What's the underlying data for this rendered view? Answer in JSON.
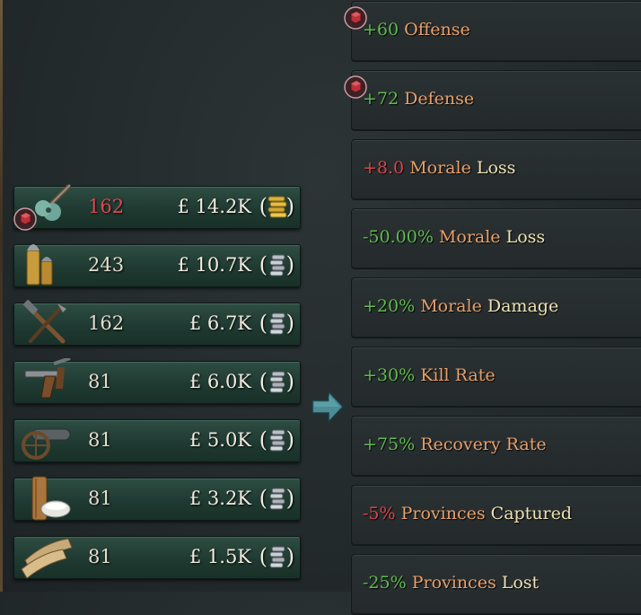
{
  "goods": [
    {
      "amount": "162",
      "shortage": true,
      "price": "£ 14.2K",
      "icon": "small-arms-icon",
      "coin": "gold-coin-stack-icon",
      "has_flag": true
    },
    {
      "amount": "243",
      "shortage": false,
      "price": "£ 10.7K",
      "icon": "ammunition-icon",
      "coin": "silver-coin-stack-icon",
      "has_flag": false
    },
    {
      "amount": "162",
      "shortage": false,
      "price": "£ 6.7K",
      "icon": "tools-icon",
      "coin": "silver-coin-stack-icon",
      "has_flag": false
    },
    {
      "amount": "81",
      "shortage": false,
      "price": "£ 6.0K",
      "icon": "pistol-icon",
      "coin": "silver-coin-stack-icon",
      "has_flag": false
    },
    {
      "amount": "81",
      "shortage": false,
      "price": "£ 5.0K",
      "icon": "artillery-icon",
      "coin": "silver-coin-stack-icon",
      "has_flag": false
    },
    {
      "amount": "81",
      "shortage": false,
      "price": "£ 3.2K",
      "icon": "rubber-icon",
      "coin": "silver-coin-stack-icon",
      "has_flag": false
    },
    {
      "amount": "81",
      "shortage": false,
      "price": "£ 1.5K",
      "icon": "fabric-icon",
      "coin": "silver-coin-stack-icon",
      "has_flag": false
    }
  ],
  "modifiers": [
    {
      "value": "+60",
      "sign": "pos",
      "word1": "Offense",
      "word2": "",
      "has_flag": true
    },
    {
      "value": "+72",
      "sign": "pos",
      "word1": "Defense",
      "word2": "",
      "has_flag": true
    },
    {
      "value": "+8.0",
      "sign": "neg",
      "word1": "Morale",
      "word2": "Loss",
      "has_flag": false
    },
    {
      "value": "-50.00%",
      "sign": "pos",
      "word1": "Morale",
      "word2": "Loss",
      "has_flag": false
    },
    {
      "value": "+20%",
      "sign": "pos",
      "word1": "Morale",
      "word2": "Damage",
      "has_flag": false
    },
    {
      "value": "+30%",
      "sign": "pos",
      "word1": "Kill Rate",
      "word2": "",
      "has_flag": false
    },
    {
      "value": "+75%",
      "sign": "pos",
      "word1": "Recovery Rate",
      "word2": "",
      "has_flag": false
    },
    {
      "value": "-5%",
      "sign": "neg",
      "word1": "Provinces",
      "word2": "Captured",
      "has_flag": false
    },
    {
      "value": "-25%",
      "sign": "pos",
      "word1": "Provinces",
      "word2": "Lost",
      "has_flag": false
    }
  ],
  "colors": {
    "positive": "#5fbb4f",
    "negative": "#d9464a",
    "label_orange": "#e9a06a",
    "label_cream": "#efe3b4",
    "row_green": "#2e4d43"
  }
}
